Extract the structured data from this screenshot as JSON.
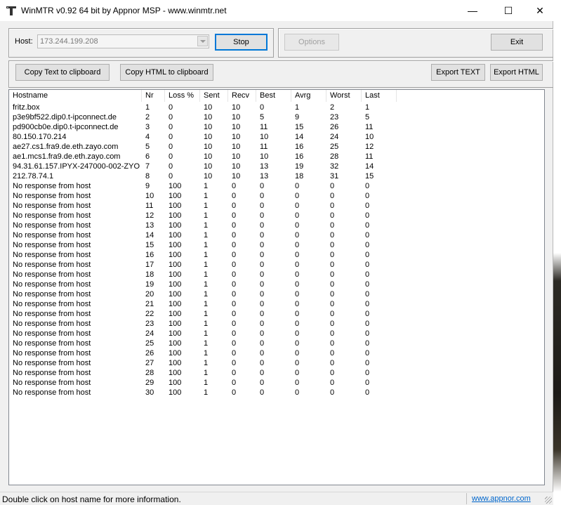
{
  "window": {
    "title": "WinMTR v0.92 64 bit by Appnor MSP - www.winmtr.net",
    "controls": {
      "minimize": "—",
      "maximize": "☐",
      "close": "✕"
    }
  },
  "host": {
    "label": "Host:",
    "value": "173.244.199.208"
  },
  "buttons": {
    "stop": "Stop",
    "options": "Options",
    "exit": "Exit",
    "copy_text": "Copy Text to clipboard",
    "copy_html": "Copy HTML to clipboard",
    "export_text": "Export TEXT",
    "export_html": "Export HTML"
  },
  "table": {
    "columns": [
      "Hostname",
      "Nr",
      "Loss %",
      "Sent",
      "Recv",
      "Best",
      "Avrg",
      "Worst",
      "Last"
    ],
    "rows": [
      [
        "fritz.box",
        "1",
        "0",
        "10",
        "10",
        "0",
        "1",
        "2",
        "1"
      ],
      [
        "p3e9bf522.dip0.t-ipconnect.de",
        "2",
        "0",
        "10",
        "10",
        "5",
        "9",
        "23",
        "5"
      ],
      [
        "pd900cb0e.dip0.t-ipconnect.de",
        "3",
        "0",
        "10",
        "10",
        "11",
        "15",
        "26",
        "11"
      ],
      [
        "80.150.170.214",
        "4",
        "0",
        "10",
        "10",
        "10",
        "14",
        "24",
        "10"
      ],
      [
        "ae27.cs1.fra9.de.eth.zayo.com",
        "5",
        "0",
        "10",
        "10",
        "11",
        "16",
        "25",
        "12"
      ],
      [
        "ae1.mcs1.fra9.de.eth.zayo.com",
        "6",
        "0",
        "10",
        "10",
        "10",
        "16",
        "28",
        "11"
      ],
      [
        "94.31.61.157.IPYX-247000-002-ZYO...",
        "7",
        "0",
        "10",
        "10",
        "13",
        "19",
        "32",
        "14"
      ],
      [
        "212.78.74.1",
        "8",
        "0",
        "10",
        "10",
        "13",
        "18",
        "31",
        "15"
      ],
      [
        "No response from host",
        "9",
        "100",
        "1",
        "0",
        "0",
        "0",
        "0",
        "0"
      ],
      [
        "No response from host",
        "10",
        "100",
        "1",
        "0",
        "0",
        "0",
        "0",
        "0"
      ],
      [
        "No response from host",
        "11",
        "100",
        "1",
        "0",
        "0",
        "0",
        "0",
        "0"
      ],
      [
        "No response from host",
        "12",
        "100",
        "1",
        "0",
        "0",
        "0",
        "0",
        "0"
      ],
      [
        "No response from host",
        "13",
        "100",
        "1",
        "0",
        "0",
        "0",
        "0",
        "0"
      ],
      [
        "No response from host",
        "14",
        "100",
        "1",
        "0",
        "0",
        "0",
        "0",
        "0"
      ],
      [
        "No response from host",
        "15",
        "100",
        "1",
        "0",
        "0",
        "0",
        "0",
        "0"
      ],
      [
        "No response from host",
        "16",
        "100",
        "1",
        "0",
        "0",
        "0",
        "0",
        "0"
      ],
      [
        "No response from host",
        "17",
        "100",
        "1",
        "0",
        "0",
        "0",
        "0",
        "0"
      ],
      [
        "No response from host",
        "18",
        "100",
        "1",
        "0",
        "0",
        "0",
        "0",
        "0"
      ],
      [
        "No response from host",
        "19",
        "100",
        "1",
        "0",
        "0",
        "0",
        "0",
        "0"
      ],
      [
        "No response from host",
        "20",
        "100",
        "1",
        "0",
        "0",
        "0",
        "0",
        "0"
      ],
      [
        "No response from host",
        "21",
        "100",
        "1",
        "0",
        "0",
        "0",
        "0",
        "0"
      ],
      [
        "No response from host",
        "22",
        "100",
        "1",
        "0",
        "0",
        "0",
        "0",
        "0"
      ],
      [
        "No response from host",
        "23",
        "100",
        "1",
        "0",
        "0",
        "0",
        "0",
        "0"
      ],
      [
        "No response from host",
        "24",
        "100",
        "1",
        "0",
        "0",
        "0",
        "0",
        "0"
      ],
      [
        "No response from host",
        "25",
        "100",
        "1",
        "0",
        "0",
        "0",
        "0",
        "0"
      ],
      [
        "No response from host",
        "26",
        "100",
        "1",
        "0",
        "0",
        "0",
        "0",
        "0"
      ],
      [
        "No response from host",
        "27",
        "100",
        "1",
        "0",
        "0",
        "0",
        "0",
        "0"
      ],
      [
        "No response from host",
        "28",
        "100",
        "1",
        "0",
        "0",
        "0",
        "0",
        "0"
      ],
      [
        "No response from host",
        "29",
        "100",
        "1",
        "0",
        "0",
        "0",
        "0",
        "0"
      ],
      [
        "No response from host",
        "30",
        "100",
        "1",
        "0",
        "0",
        "0",
        "0",
        "0"
      ]
    ]
  },
  "status": {
    "message": "Double click on host name for more information.",
    "link": "www.appnor.com"
  },
  "colors": {
    "link": "#0066cc",
    "default_button_border": "#0078d7"
  }
}
